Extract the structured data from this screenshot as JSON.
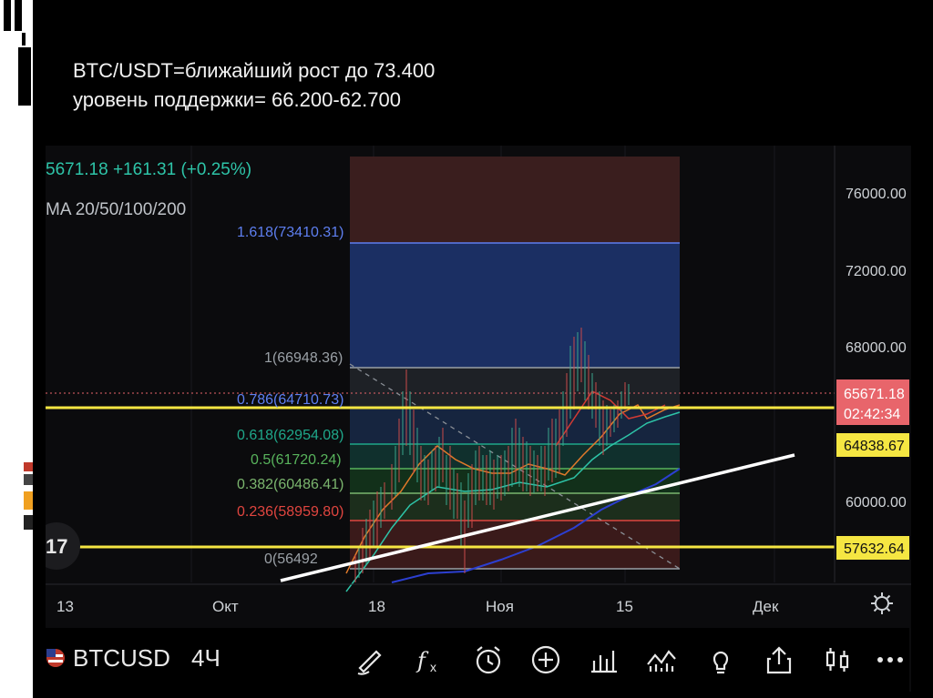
{
  "slide": {
    "title_line1": "BTC/USDT=ближайший рост до 73.400",
    "title_line2": "уровень поддержки= 66.200-62.700"
  },
  "chart_header": {
    "price_change": "5671.18 +161.31 (+0.25%)",
    "indicator": "MA 20/50/100/200"
  },
  "fib_levels": [
    {
      "label": "1.618(73410.31)",
      "value": 73410.31,
      "color": "#5e7ff0"
    },
    {
      "label": "1(66948.36)",
      "value": 66948.36,
      "color": "#9aa0a6"
    },
    {
      "label": "0.786(64710.73)",
      "value": 64710.73,
      "color": "#5e7ff0"
    },
    {
      "label": "0.618(62954.08)",
      "value": 62954.08,
      "color": "#1fa78a"
    },
    {
      "label": "0.5(61720.24)",
      "value": 61720.24,
      "color": "#58b35c"
    },
    {
      "label": "0.382(60486.41)",
      "value": 60486.41,
      "color": "#7bb56e"
    },
    {
      "label": "0.236(58959.80)",
      "value": 58959.8,
      "color": "#e0453f"
    },
    {
      "label": "0(56492",
      "value": 56492,
      "color": "#9aa0a6"
    }
  ],
  "price_axis": {
    "ticks": [
      {
        "label": "76000.00",
        "value": 76000
      },
      {
        "label": "72000.00",
        "value": 72000
      },
      {
        "label": "68000.00",
        "value": 68000
      },
      {
        "label": "60000.00",
        "value": 60000
      }
    ],
    "current_price": "65671.18",
    "countdown": "02:42:34",
    "level_upper": "64838.67",
    "level_lower": "57632.64"
  },
  "time_axis": [
    "13",
    "Окт",
    "18",
    "Ноя",
    "15",
    "Дек"
  ],
  "toolbar": {
    "symbol": "BTCUSD",
    "interval": "4Ч"
  },
  "colors": {
    "fib_top_zone": "#3a1e1e",
    "fib_blue_zone": "#1b2f63",
    "yellow_line": "#f5e642",
    "label_red": "#e8656b",
    "label_yellow": "#f5e642",
    "trendline": "#ffffff"
  }
}
